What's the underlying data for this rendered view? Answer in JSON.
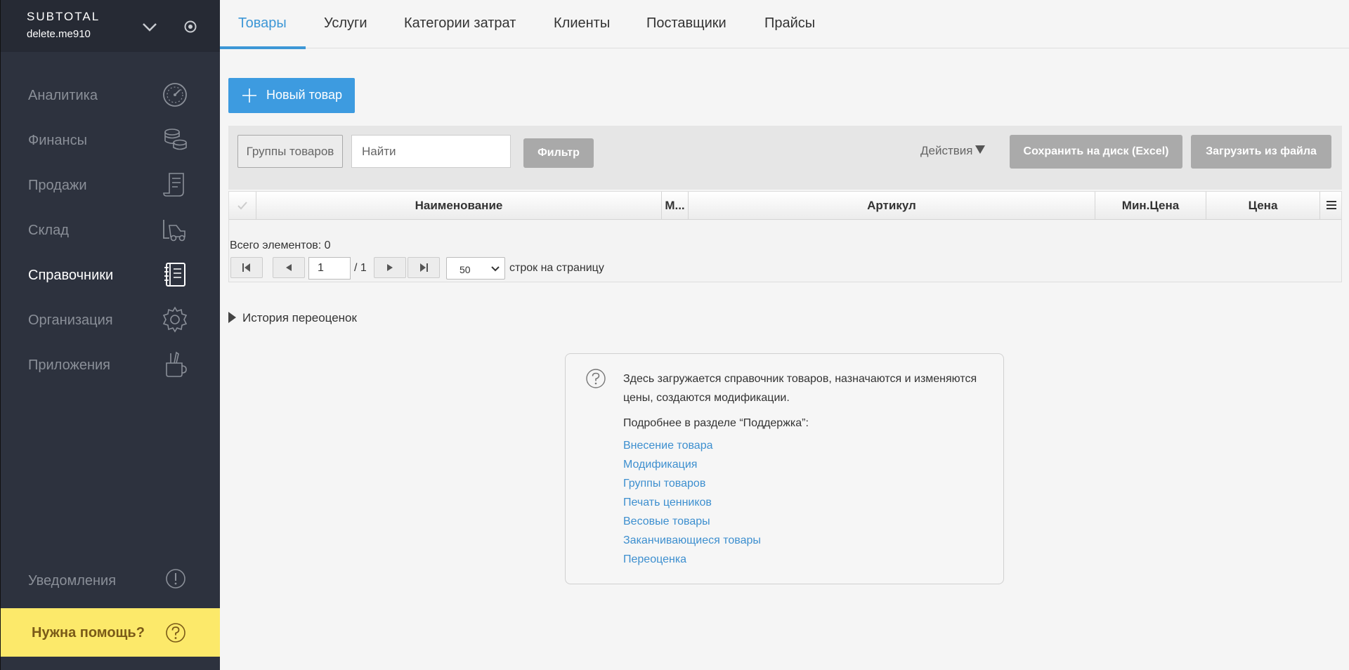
{
  "sidebar": {
    "brand": "SUBTOTAL",
    "account": "delete.me910",
    "items": [
      {
        "label": "Аналитика",
        "icon": "speedometer-icon",
        "active": false
      },
      {
        "label": "Финансы",
        "icon": "coins-icon",
        "active": false
      },
      {
        "label": "Продажи",
        "icon": "receipt-icon",
        "active": false
      },
      {
        "label": "Склад",
        "icon": "forklift-icon",
        "active": false
      },
      {
        "label": "Справочники",
        "icon": "notebook-icon",
        "active": true
      },
      {
        "label": "Организация",
        "icon": "gear-icon",
        "active": false
      },
      {
        "label": "Приложения",
        "icon": "tools-cup-icon",
        "active": false
      }
    ],
    "notifications_label": "Уведомления",
    "help_label": "Нужна помощь?"
  },
  "tabs": [
    "Товары",
    "Услуги",
    "Категории затрат",
    "Клиенты",
    "Поставщики",
    "Прайсы"
  ],
  "toolbar": {
    "new_button": "Новый товар",
    "groups_button": "Группы товаров",
    "search_placeholder": "Найти",
    "filter_button": "Фильтр",
    "actions_label": "Действия",
    "save_button": "Сохранить на диск (Excel)",
    "load_button": "Загрузить из файла"
  },
  "grid": {
    "columns": [
      "Наименование",
      "М...",
      "Артикул",
      "Мин.Цена",
      "Цена"
    ],
    "total_label": "Всего элементов: 0",
    "page_value": "1",
    "page_of": "/ 1",
    "rows_per_page": "50",
    "rows_label": "строк на страницу"
  },
  "history_label": "История переоценок",
  "info": {
    "description": "Здесь загружается справочник товаров, назначаются и изменяются цены, создаются модификации.",
    "more_label": "Подробнее в разделе “Поддержка”:",
    "links": [
      "Внесение товара",
      "Модификация",
      "Группы товаров",
      "Печать ценников",
      "Весовые товары",
      "Заканчивающиеся товары",
      "Переоценка"
    ]
  },
  "colors": {
    "sidebar_bg": "#2d323e",
    "accent": "#3d97d6",
    "help_bg": "#fce96a",
    "link": "#3d8fcf"
  }
}
